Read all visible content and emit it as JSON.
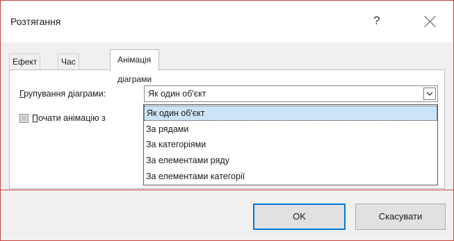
{
  "dialog": {
    "title": "Розтягання",
    "help_label": "?"
  },
  "tabs": [
    {
      "label": "Ефект"
    },
    {
      "label": "Час"
    },
    {
      "label": "Анімація діаграми"
    }
  ],
  "group": {
    "label_first": "Г",
    "label_rest": "рупування діаграми:",
    "selected_value": "Як один об'єкт",
    "options": [
      "Як один об'єкт",
      "За рядами",
      "За категоріями",
      "За елементами ряду",
      "За елементами категорії"
    ]
  },
  "start_animation": {
    "label_first": "П",
    "label_rest": "очати анімацію з",
    "checked": false
  },
  "buttons": {
    "ok": "OK",
    "cancel": "Скасувати"
  }
}
